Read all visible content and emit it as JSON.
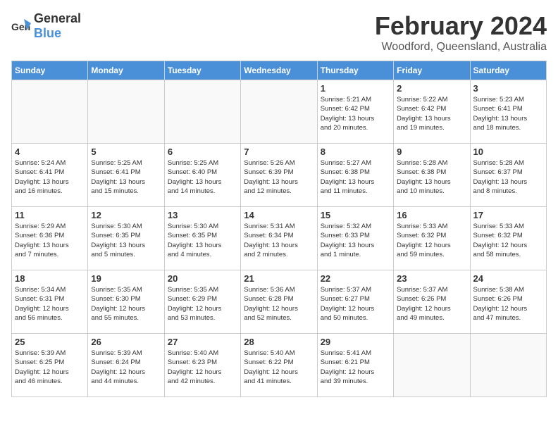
{
  "header": {
    "logo_general": "General",
    "logo_blue": "Blue",
    "month": "February 2024",
    "location": "Woodford, Queensland, Australia"
  },
  "weekdays": [
    "Sunday",
    "Monday",
    "Tuesday",
    "Wednesday",
    "Thursday",
    "Friday",
    "Saturday"
  ],
  "weeks": [
    [
      {
        "day": "",
        "info": ""
      },
      {
        "day": "",
        "info": ""
      },
      {
        "day": "",
        "info": ""
      },
      {
        "day": "",
        "info": ""
      },
      {
        "day": "1",
        "info": "Sunrise: 5:21 AM\nSunset: 6:42 PM\nDaylight: 13 hours\nand 20 minutes."
      },
      {
        "day": "2",
        "info": "Sunrise: 5:22 AM\nSunset: 6:42 PM\nDaylight: 13 hours\nand 19 minutes."
      },
      {
        "day": "3",
        "info": "Sunrise: 5:23 AM\nSunset: 6:41 PM\nDaylight: 13 hours\nand 18 minutes."
      }
    ],
    [
      {
        "day": "4",
        "info": "Sunrise: 5:24 AM\nSunset: 6:41 PM\nDaylight: 13 hours\nand 16 minutes."
      },
      {
        "day": "5",
        "info": "Sunrise: 5:25 AM\nSunset: 6:41 PM\nDaylight: 13 hours\nand 15 minutes."
      },
      {
        "day": "6",
        "info": "Sunrise: 5:25 AM\nSunset: 6:40 PM\nDaylight: 13 hours\nand 14 minutes."
      },
      {
        "day": "7",
        "info": "Sunrise: 5:26 AM\nSunset: 6:39 PM\nDaylight: 13 hours\nand 12 minutes."
      },
      {
        "day": "8",
        "info": "Sunrise: 5:27 AM\nSunset: 6:38 PM\nDaylight: 13 hours\nand 11 minutes."
      },
      {
        "day": "9",
        "info": "Sunrise: 5:28 AM\nSunset: 6:38 PM\nDaylight: 13 hours\nand 10 minutes."
      },
      {
        "day": "10",
        "info": "Sunrise: 5:28 AM\nSunset: 6:37 PM\nDaylight: 13 hours\nand 8 minutes."
      }
    ],
    [
      {
        "day": "11",
        "info": "Sunrise: 5:29 AM\nSunset: 6:36 PM\nDaylight: 13 hours\nand 7 minutes."
      },
      {
        "day": "12",
        "info": "Sunrise: 5:30 AM\nSunset: 6:35 PM\nDaylight: 13 hours\nand 5 minutes."
      },
      {
        "day": "13",
        "info": "Sunrise: 5:30 AM\nSunset: 6:35 PM\nDaylight: 13 hours\nand 4 minutes."
      },
      {
        "day": "14",
        "info": "Sunrise: 5:31 AM\nSunset: 6:34 PM\nDaylight: 13 hours\nand 2 minutes."
      },
      {
        "day": "15",
        "info": "Sunrise: 5:32 AM\nSunset: 6:33 PM\nDaylight: 13 hours\nand 1 minute."
      },
      {
        "day": "16",
        "info": "Sunrise: 5:33 AM\nSunset: 6:32 PM\nDaylight: 12 hours\nand 59 minutes."
      },
      {
        "day": "17",
        "info": "Sunrise: 5:33 AM\nSunset: 6:32 PM\nDaylight: 12 hours\nand 58 minutes."
      }
    ],
    [
      {
        "day": "18",
        "info": "Sunrise: 5:34 AM\nSunset: 6:31 PM\nDaylight: 12 hours\nand 56 minutes."
      },
      {
        "day": "19",
        "info": "Sunrise: 5:35 AM\nSunset: 6:30 PM\nDaylight: 12 hours\nand 55 minutes."
      },
      {
        "day": "20",
        "info": "Sunrise: 5:35 AM\nSunset: 6:29 PM\nDaylight: 12 hours\nand 53 minutes."
      },
      {
        "day": "21",
        "info": "Sunrise: 5:36 AM\nSunset: 6:28 PM\nDaylight: 12 hours\nand 52 minutes."
      },
      {
        "day": "22",
        "info": "Sunrise: 5:37 AM\nSunset: 6:27 PM\nDaylight: 12 hours\nand 50 minutes."
      },
      {
        "day": "23",
        "info": "Sunrise: 5:37 AM\nSunset: 6:26 PM\nDaylight: 12 hours\nand 49 minutes."
      },
      {
        "day": "24",
        "info": "Sunrise: 5:38 AM\nSunset: 6:26 PM\nDaylight: 12 hours\nand 47 minutes."
      }
    ],
    [
      {
        "day": "25",
        "info": "Sunrise: 5:39 AM\nSunset: 6:25 PM\nDaylight: 12 hours\nand 46 minutes."
      },
      {
        "day": "26",
        "info": "Sunrise: 5:39 AM\nSunset: 6:24 PM\nDaylight: 12 hours\nand 44 minutes."
      },
      {
        "day": "27",
        "info": "Sunrise: 5:40 AM\nSunset: 6:23 PM\nDaylight: 12 hours\nand 42 minutes."
      },
      {
        "day": "28",
        "info": "Sunrise: 5:40 AM\nSunset: 6:22 PM\nDaylight: 12 hours\nand 41 minutes."
      },
      {
        "day": "29",
        "info": "Sunrise: 5:41 AM\nSunset: 6:21 PM\nDaylight: 12 hours\nand 39 minutes."
      },
      {
        "day": "",
        "info": ""
      },
      {
        "day": "",
        "info": ""
      }
    ]
  ]
}
